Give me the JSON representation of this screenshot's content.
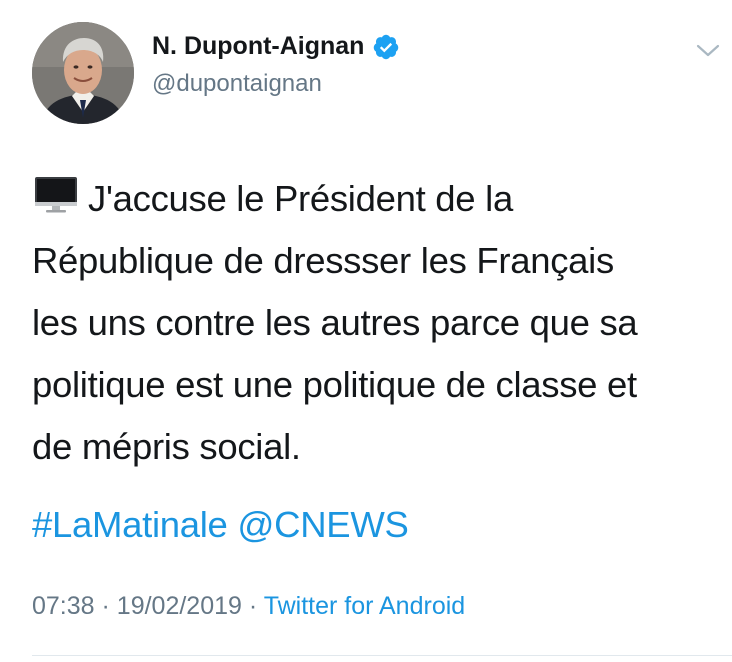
{
  "tweet": {
    "display_name": "N. Dupont-Aignan",
    "handle": "@dupontaignan",
    "verified": true,
    "icons": {
      "verified": "verified-badge-icon",
      "menu": "chevron-down-icon",
      "emoji": "desktop-computer-icon"
    },
    "text_lines": [
      "J'accuse le Président de la",
      "République de dressser les Français",
      "les uns contre les autres parce que sa",
      "politique est une politique de classe et",
      "de mépris social."
    ],
    "hashtag": "#LaMatinale",
    "mention": "@CNEWS",
    "time": "07:38",
    "separator": "·",
    "date": "19/02/2019",
    "source": "Twitter for Android"
  },
  "colors": {
    "link": "#1b95e0",
    "secondary_text": "#657786",
    "primary_text": "#14171a",
    "verified": "#1da1f2"
  }
}
